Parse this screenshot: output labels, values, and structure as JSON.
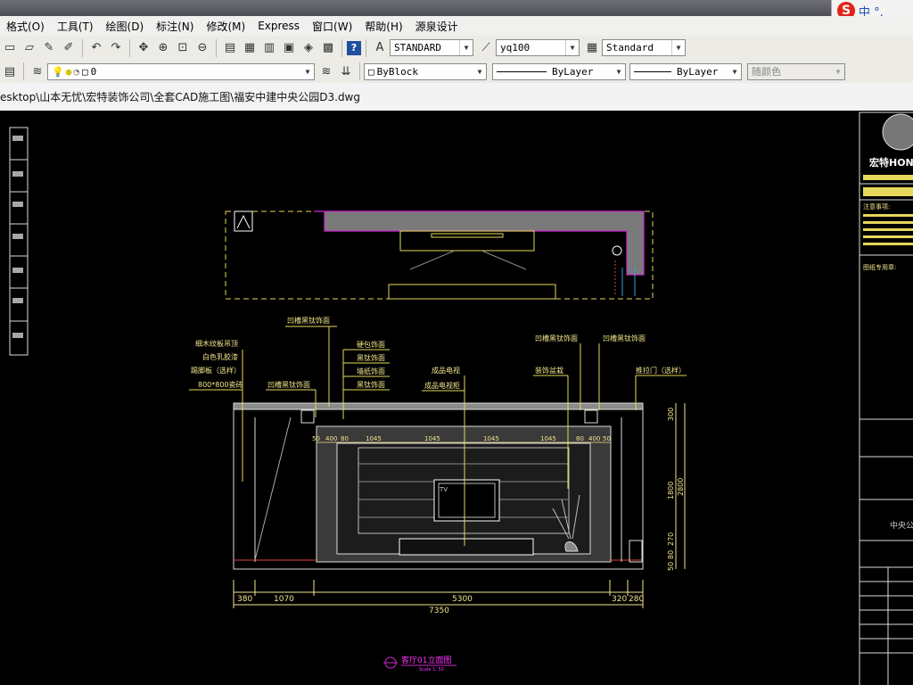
{
  "ime": {
    "label": "中 °,"
  },
  "menubar": {
    "items": [
      "格式(O)",
      "工具(T)",
      "绘图(D)",
      "标注(N)",
      "修改(M)",
      "Express",
      "窗口(W)",
      "帮助(H)",
      "源泉设计"
    ]
  },
  "toolbar1": {
    "text_style": "STANDARD",
    "dim_style": "yq100",
    "table_style": "Standard"
  },
  "toolbar2": {
    "layer": "0",
    "color": "ByBlock",
    "linetype": "ByLayer",
    "lineweight": "ByLayer",
    "plot_style": "随颜色"
  },
  "file_path": "esktop\\山本无忧\\宏特装饰公司\\全套CAD施工图\\福安中建中央公园D3.dwg",
  "drawing": {
    "callouts": {
      "top_center": "凹槽黑钛饰面",
      "ceiling": "细木纹板吊顶",
      "latex": "白色乳胶漆",
      "baseboard": "踢脚板（选样）",
      "tile": "800*800瓷砖",
      "groove_left": "凹槽黑钛饰面",
      "stone_a": "硬包饰面",
      "black_a": "黑钛饰面",
      "stone_b": "墙纸饰面",
      "black_b": "黑钛饰面",
      "tv": "成品电视",
      "tv_cabinet": "成品电视柜",
      "groove_right1": "凹槽黑钛饰面",
      "groove_right2": "凹槽黑钛饰面",
      "decor": "装饰盆栽",
      "sliding_door": "推拉门（选样）",
      "tv_label": "TV"
    },
    "inner_dims": [
      "50",
      "400",
      "80",
      "1045",
      "1045",
      "1045",
      "1045",
      "80",
      "400",
      "50"
    ],
    "right_dims": [
      "300",
      "1800",
      "2800",
      "270",
      "80",
      "50"
    ],
    "bottom_dims": [
      "380",
      "1070",
      "5300",
      "320",
      "280"
    ],
    "total_dim": "7350",
    "title": "客厅01立面图",
    "scale": "Scale 1: 50"
  },
  "title_block": {
    "brand": "宏特HON",
    "notes_header": "注意事项:",
    "drawing_header": "图纸专用章:",
    "project": "中央公"
  }
}
